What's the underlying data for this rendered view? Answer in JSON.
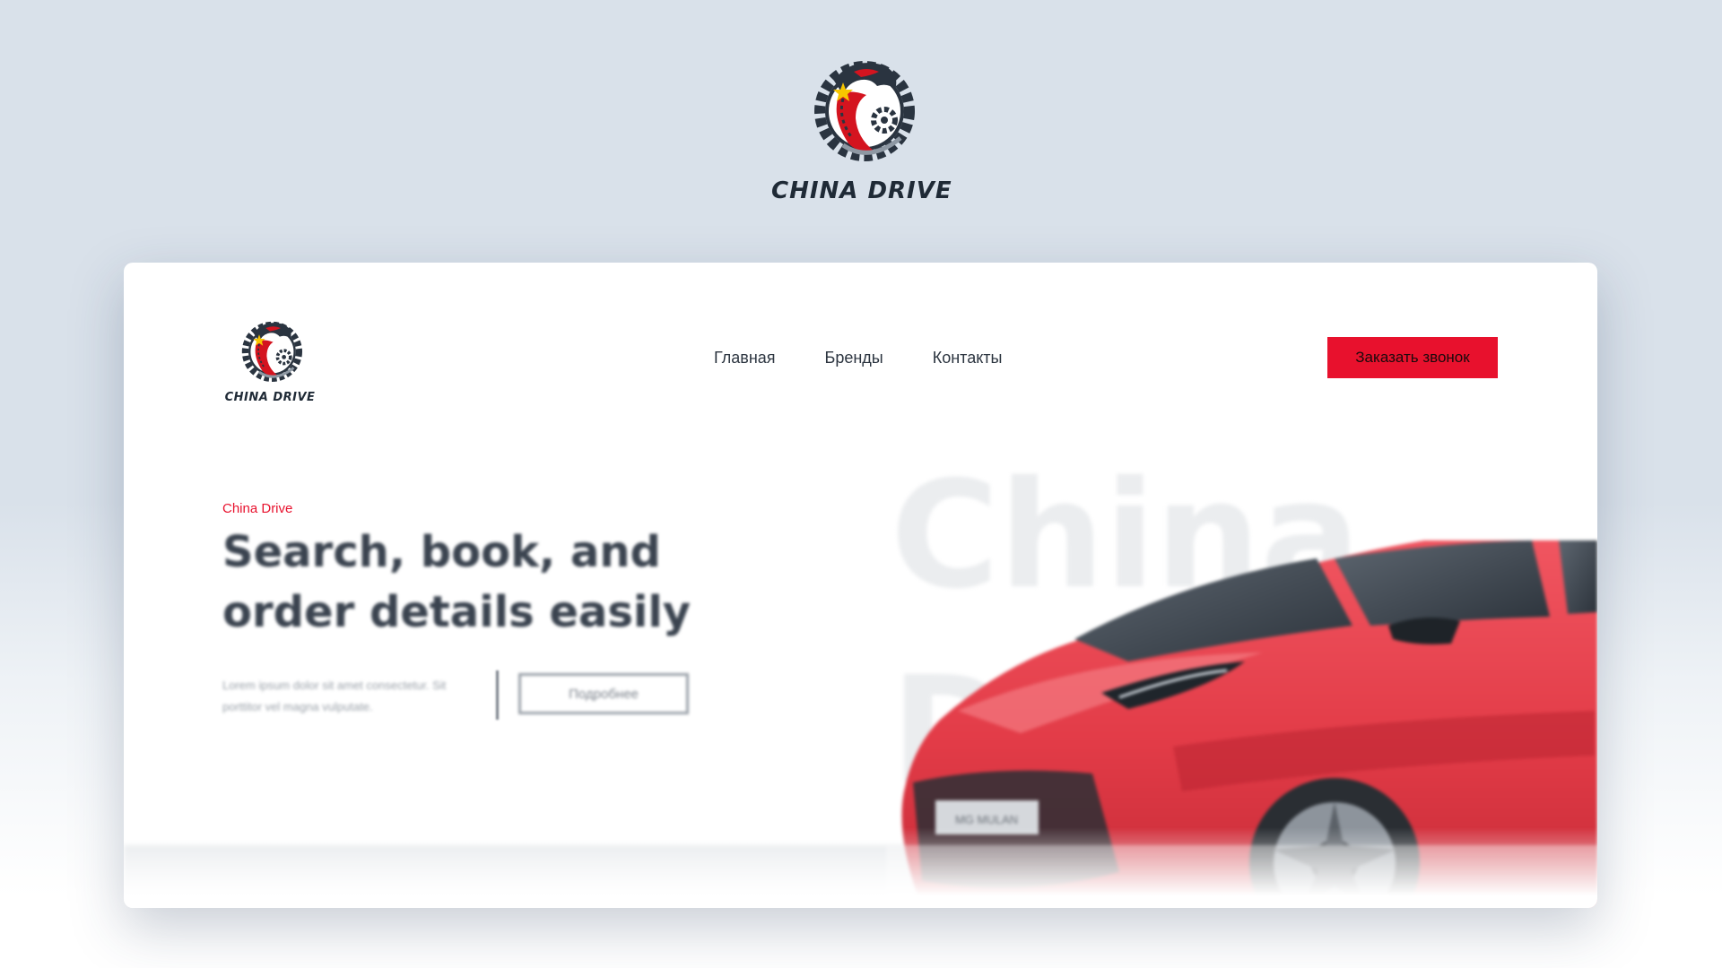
{
  "brand": {
    "name": "CHINA DRIVE",
    "card_name": "CHINA DRIVE"
  },
  "nav": {
    "items": [
      {
        "label": "Главная"
      },
      {
        "label": "Бренды"
      },
      {
        "label": "Контакты"
      }
    ]
  },
  "header": {
    "cta_label": "Заказать звонок"
  },
  "hero": {
    "overline": "China Drive",
    "title": "Search, book, and order details easily",
    "text": "Lorem ipsum dolor sit amet consectetur. Sit porttitor vel magna vulputate.",
    "more_label": "Подробнее",
    "bg_text": "China\nD",
    "plate": "MG MULAN"
  },
  "colors": {
    "accent": "#e8112d",
    "background": "#d9e1ea",
    "dark": "#1f2a36"
  }
}
